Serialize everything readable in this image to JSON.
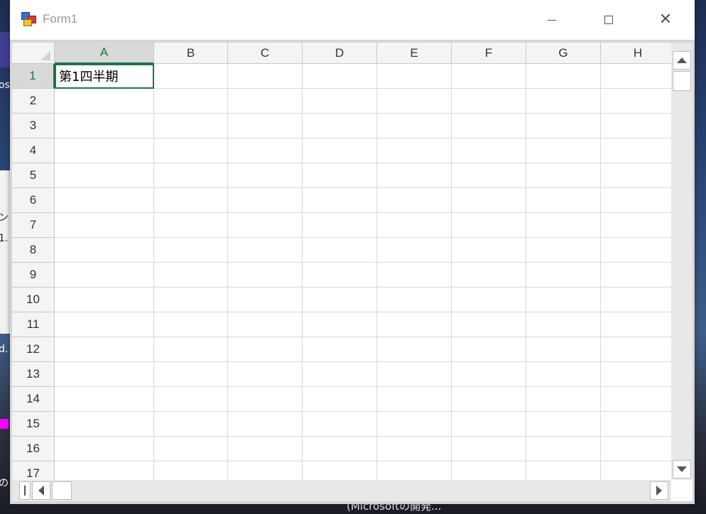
{
  "window": {
    "title": "Form1"
  },
  "desktop": {
    "fragments": [
      "os",
      "ン",
      "1.",
      "d.",
      "の"
    ],
    "taskbar_caption": "(Microsoftの開発..."
  },
  "sheet": {
    "columns": [
      "A",
      "B",
      "C",
      "D",
      "E",
      "F",
      "G",
      "H"
    ],
    "rows": [
      "1",
      "2",
      "3",
      "4",
      "5",
      "6",
      "7",
      "8",
      "9",
      "10",
      "11",
      "12",
      "13",
      "14",
      "15",
      "16",
      "17"
    ],
    "active_cell": "A1",
    "cells": {
      "A1": "第1四半期"
    }
  },
  "colors": {
    "selection_accent": "#217346",
    "header_bg": "#f4f4f4",
    "selected_header_bg": "#d9d9d9"
  }
}
